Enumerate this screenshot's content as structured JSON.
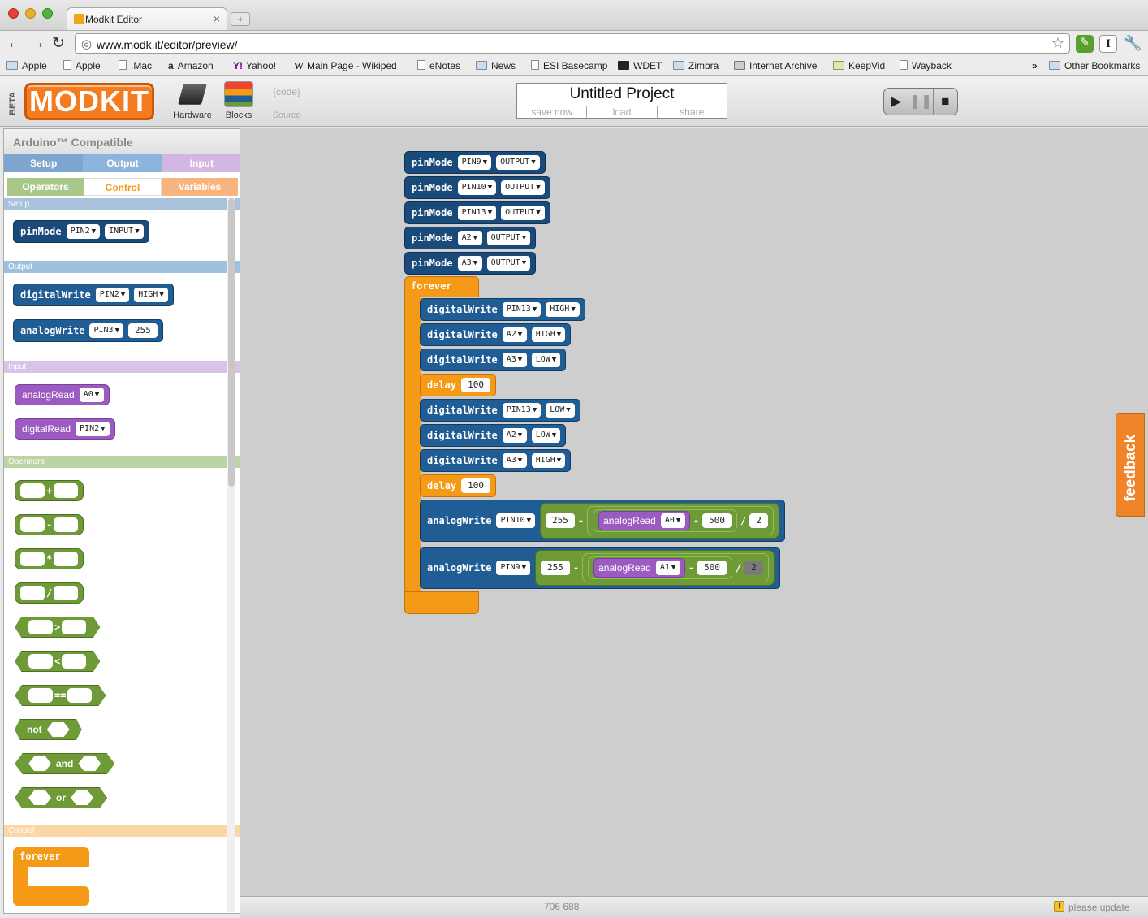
{
  "browser": {
    "tab_title": "Modkit Editor",
    "url": "www.modk.it/editor/preview/",
    "bookmarks": [
      "Apple",
      "Apple",
      ".Mac",
      "Amazon",
      "Yahoo!",
      "Main Page - Wikiped",
      "eNotes",
      "News",
      "ESI Basecamp",
      "WDET",
      "Zimbra",
      "Internet Archive",
      "KeepVid",
      "Wayback"
    ],
    "other_bookmarks": "Other Bookmarks",
    "overflow": "»"
  },
  "header": {
    "beta": "BETA",
    "logo": "MODKIT",
    "tools": [
      "Hardware",
      "Blocks",
      "Source"
    ],
    "code_tag": "{code}",
    "project_title": "Untitled Project",
    "project_actions": [
      "save now",
      "load",
      "share"
    ]
  },
  "sidebar": {
    "title": "Arduino™ Compatible",
    "tabs_row1": [
      "Setup",
      "Output",
      "Input"
    ],
    "tabs_row2": [
      "Operators",
      "Control",
      "Variables"
    ],
    "sections": [
      "Setup",
      "Output",
      "Input",
      "Operators",
      "Control"
    ],
    "palette": {
      "pinmode": {
        "name": "pinMode",
        "pin": "PIN2",
        "mode": "INPUT"
      },
      "digitalwrite": {
        "name": "digitalWrite",
        "pin": "PIN2",
        "val": "HIGH"
      },
      "analogwrite": {
        "name": "analogWrite",
        "pin": "PIN3",
        "val": "255"
      },
      "analogread": {
        "name": "analogRead",
        "pin": "A0"
      },
      "digitalread": {
        "name": "digitalRead",
        "pin": "PIN2"
      },
      "ops": [
        "+",
        "-",
        "*",
        "/",
        ">",
        "<",
        "=="
      ],
      "logic": [
        "not",
        "and",
        "or"
      ],
      "forever": "forever"
    }
  },
  "program": {
    "setup": [
      {
        "cmd": "pinMode",
        "pin": "PIN9",
        "mode": "OUTPUT"
      },
      {
        "cmd": "pinMode",
        "pin": "PIN10",
        "mode": "OUTPUT"
      },
      {
        "cmd": "pinMode",
        "pin": "PIN13",
        "mode": "OUTPUT"
      },
      {
        "cmd": "pinMode",
        "pin": "A2",
        "mode": "OUTPUT"
      },
      {
        "cmd": "pinMode",
        "pin": "A3",
        "mode": "OUTPUT"
      }
    ],
    "forever": "forever",
    "loop": [
      {
        "cmd": "digitalWrite",
        "pin": "PIN13",
        "val": "HIGH"
      },
      {
        "cmd": "digitalWrite",
        "pin": "A2",
        "val": "HIGH"
      },
      {
        "cmd": "digitalWrite",
        "pin": "A3",
        "val": "LOW"
      },
      {
        "cmd": "delay",
        "val": "100"
      },
      {
        "cmd": "digitalWrite",
        "pin": "PIN13",
        "val": "LOW"
      },
      {
        "cmd": "digitalWrite",
        "pin": "A2",
        "val": "LOW"
      },
      {
        "cmd": "digitalWrite",
        "pin": "A3",
        "val": "HIGH"
      },
      {
        "cmd": "delay",
        "val": "100"
      }
    ],
    "aw1": {
      "cmd": "analogWrite",
      "pin": "PIN10",
      "a": "255",
      "op1": "-",
      "read": "analogRead",
      "rpin": "A0",
      "op2": "-",
      "b": "500",
      "op3": "/",
      "c": "2"
    },
    "aw2": {
      "cmd": "analogWrite",
      "pin": "PIN9",
      "a": "255",
      "op1": "-",
      "read": "analogRead",
      "rpin": "A1",
      "op2": "-",
      "b": "500",
      "op3": "/",
      "c": "2"
    }
  },
  "status": {
    "coords": "706 688",
    "update": "please update"
  },
  "feedback": "feedback",
  "colors": {
    "setup": "#1a4a7a",
    "output": "#1f5d94",
    "input": "#9b5bc1",
    "operators": "#6e9a37",
    "control": "#f59a16"
  }
}
